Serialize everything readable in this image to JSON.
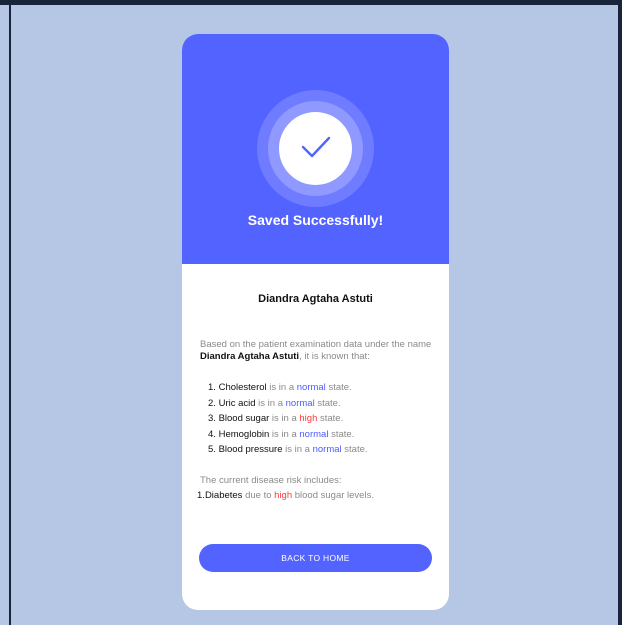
{
  "colors": {
    "background": "#b5c7e5",
    "accent": "#5263ff",
    "normal_state": "#4b5cff",
    "high_state": "#ff3b3b"
  },
  "header": {
    "icon": "check-icon",
    "title": "Saved Successfully!"
  },
  "patient": {
    "name": "Diandra Agtaha Astuti"
  },
  "intro": {
    "prefix": "Based on the patient examination data under the name ",
    "name": "Diandra Agtaha Astuti",
    "suffix": ", it is known that:"
  },
  "results": [
    {
      "number": "1.",
      "name": "Cholesterol",
      "connector": "is in a",
      "state": "normal",
      "tail": "state."
    },
    {
      "number": "2.",
      "name": "Uric acid",
      "connector": "is in a",
      "state": "normal",
      "tail": "state."
    },
    {
      "number": "3.",
      "name": "Blood sugar",
      "connector": "is in a",
      "state": "high",
      "tail": "state."
    },
    {
      "number": "4.",
      "name": "Hemoglobin",
      "connector": "is in a",
      "state": "normal",
      "tail": "state."
    },
    {
      "number": "5.",
      "name": "Blood pressure",
      "connector": "is in a",
      "state": "normal",
      "tail": "state."
    }
  ],
  "risk": {
    "title": "The current disease risk includes:",
    "items": [
      {
        "number": "1.",
        "name": "Diabetes",
        "connector": "due to",
        "level": "high",
        "tail": "blood sugar levels."
      }
    ]
  },
  "button": {
    "label": "BACK TO HOME"
  }
}
